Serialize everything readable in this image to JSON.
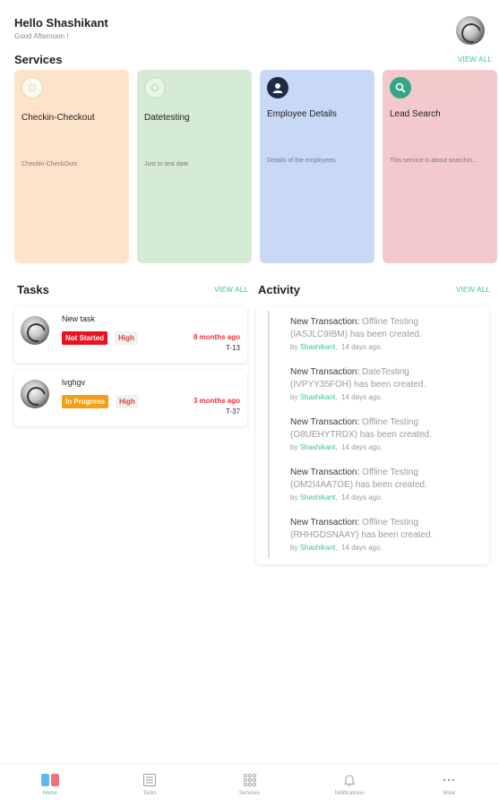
{
  "header": {
    "greeting": "Hello Shashikant",
    "subtitle": "Good Afternoon !"
  },
  "services": {
    "title": "Services",
    "view_all": "VIEW ALL",
    "items": [
      {
        "title": "Checkin-Checkout",
        "description": "Checkin-CheckOuts",
        "bg": "#fde3c9",
        "icon": "circle-outline-icon"
      },
      {
        "title": "Datetesting",
        "description": "Just to test date",
        "bg": "#d6ebd4",
        "icon": "circle-outline-icon"
      },
      {
        "title": "Employee Details",
        "description": "Details of the employees",
        "bg": "#c9d8f7",
        "icon": "user-icon"
      },
      {
        "title": "Lead Search",
        "description": "This service is about searchin...",
        "bg": "#f3c9cc",
        "icon": "search-icon"
      }
    ]
  },
  "tasks": {
    "title": "Tasks",
    "view_all": "VIEW ALL",
    "items": [
      {
        "name": "New task",
        "status": "Not Started",
        "priority": "High",
        "time": "8 months ago",
        "id": "T-13"
      },
      {
        "name": "lvghgv",
        "status": "In Progress",
        "priority": "High",
        "time": "3 months ago",
        "id": "T-37"
      }
    ]
  },
  "activity": {
    "title": "Activity",
    "view_all": "VIEW ALL",
    "items": [
      {
        "lead": "New Transaction:",
        "service": "Offline Testing",
        "code": "(IASJLC9IBM)",
        "suffix": "has been created.",
        "by": "by",
        "author": "Shashikant",
        "time": "14 days ago."
      },
      {
        "lead": "New Transaction:",
        "service": "DateTesting",
        "code": "(IVPYY35FOH)",
        "suffix": "has been created.",
        "by": "by",
        "author": "Shashikant",
        "time": "14 days ago."
      },
      {
        "lead": "New Transaction:",
        "service": "Offline Testing",
        "code": "(O8UEHYTRDX)",
        "suffix": "has been created.",
        "by": "by",
        "author": "Shashikant",
        "time": "14 days ago."
      },
      {
        "lead": "New Transaction:",
        "service": "Offline Testing",
        "code": "(OM2I4AA7OE)",
        "suffix": "has been created.",
        "by": "by",
        "author": "Shashikant",
        "time": "14 days ago."
      },
      {
        "lead": "New Transaction:",
        "service": "Offline Testing",
        "code": "(RHHGDSNAAY)",
        "suffix": "has been created.",
        "by": "by",
        "author": "Shashikant",
        "time": "14 days ago."
      }
    ]
  },
  "nav": {
    "items": [
      {
        "label": "Home",
        "icon": "home-icon",
        "active": true
      },
      {
        "label": "Tasks",
        "icon": "tasks-icon",
        "active": false
      },
      {
        "label": "Services",
        "icon": "services-grid-icon",
        "active": false
      },
      {
        "label": "Notifications",
        "icon": "bell-icon",
        "active": false
      },
      {
        "label": "More",
        "icon": "more-icon",
        "active": false
      }
    ]
  },
  "colors": {
    "accent": "#3cc49c",
    "status_not_started": "#e8131f",
    "status_in_progress": "#f59e16",
    "priority_text": "#e43b3b"
  }
}
